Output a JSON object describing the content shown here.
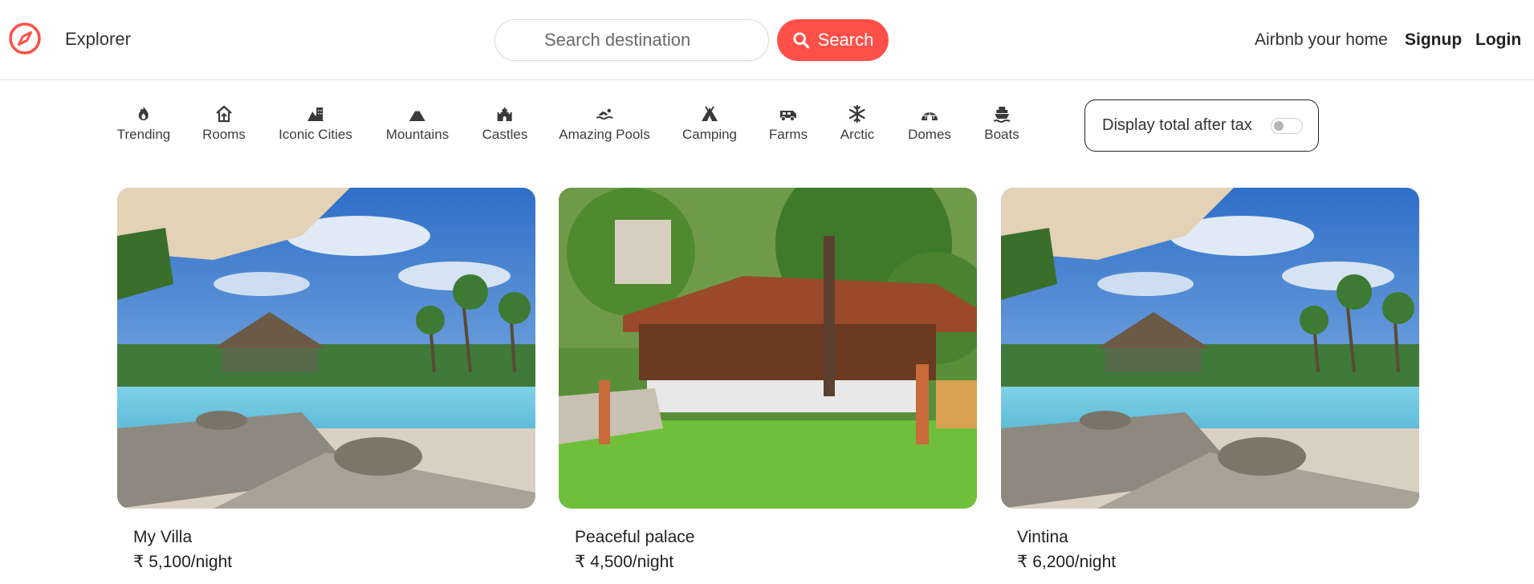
{
  "header": {
    "brand": "Explorer",
    "search_placeholder": "Search destination",
    "search_button": "Search",
    "nav": {
      "host": "Airbnb your home",
      "signup": "Signup",
      "login": "Login"
    },
    "accent_color": "#fe5048"
  },
  "categories": [
    {
      "label": "Trending",
      "icon": "fire-icon"
    },
    {
      "label": "Rooms",
      "icon": "home-icon"
    },
    {
      "label": "Iconic Cities",
      "icon": "city-icon"
    },
    {
      "label": "Mountains",
      "icon": "mountain-icon"
    },
    {
      "label": "Castles",
      "icon": "castle-icon"
    },
    {
      "label": "Amazing Pools",
      "icon": "swimmer-icon"
    },
    {
      "label": "Camping",
      "icon": "campground-icon"
    },
    {
      "label": "Farms",
      "icon": "tractor-icon"
    },
    {
      "label": "Arctic",
      "icon": "snowflake-icon"
    },
    {
      "label": "Domes",
      "icon": "igloo-icon"
    },
    {
      "label": "Boats",
      "icon": "ship-icon"
    }
  ],
  "tax_toggle": {
    "label": "Display total after tax",
    "enabled": false
  },
  "listings": [
    {
      "title": "My Villa",
      "price": "₹ 5,100/night",
      "image": "resort-pool-photo"
    },
    {
      "title": "Peaceful palace",
      "price": "₹ 4,500/night",
      "image": "wooden-house-garden-photo"
    },
    {
      "title": "Vintina",
      "price": "₹ 6,200/night",
      "image": "resort-pool-photo"
    }
  ]
}
